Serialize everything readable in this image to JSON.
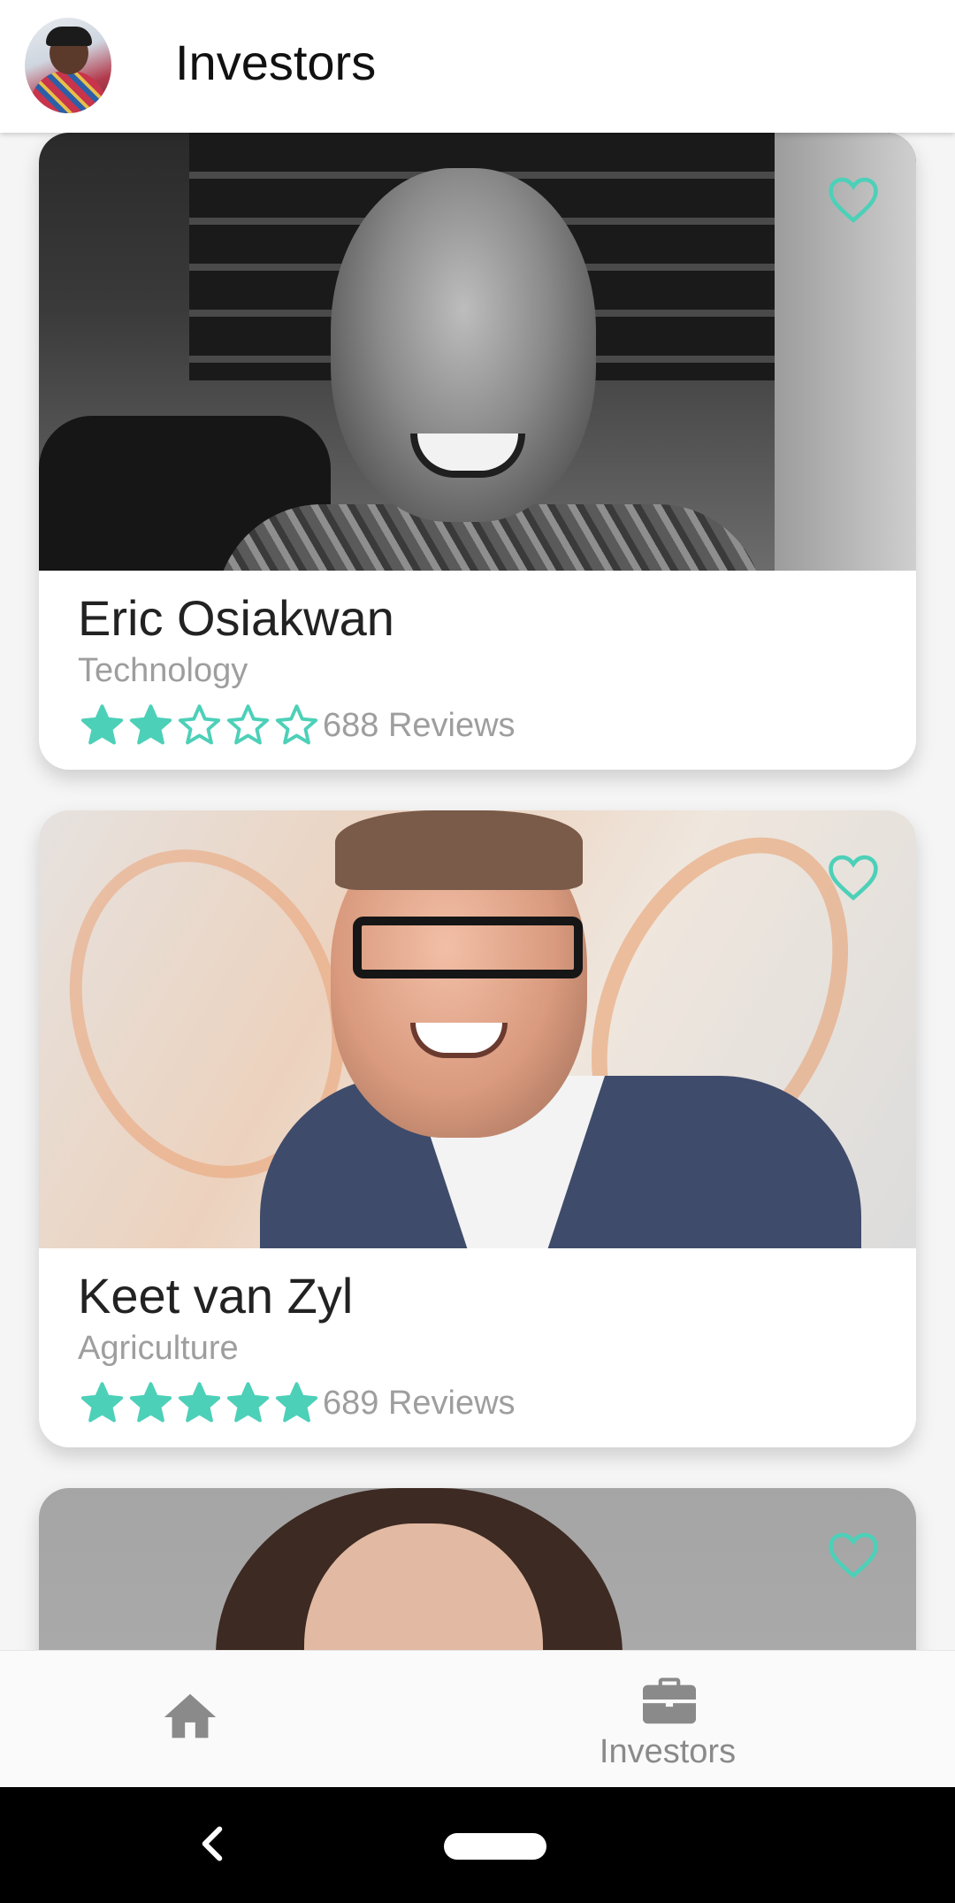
{
  "appbar": {
    "title": "Investors"
  },
  "accent_color": "#4dd0b8",
  "investors": [
    {
      "name": "Eric Osiakwan",
      "category": "Technology",
      "rating": 2,
      "max_rating": 5,
      "reviews": "688 Reviews",
      "favorite": false
    },
    {
      "name": "Keet van Zyl",
      "category": "Agriculture",
      "rating": 5,
      "max_rating": 5,
      "reviews": "689 Reviews",
      "favorite": false
    },
    {
      "name": "",
      "category": "",
      "rating": null,
      "reviews": "",
      "favorite": false
    }
  ],
  "bottom_nav": {
    "items": [
      {
        "icon": "home-icon",
        "label": ""
      },
      {
        "icon": "briefcase-icon",
        "label": "Investors"
      }
    ]
  },
  "system_nav": {
    "icons": [
      "back-icon",
      "home-pill"
    ]
  }
}
